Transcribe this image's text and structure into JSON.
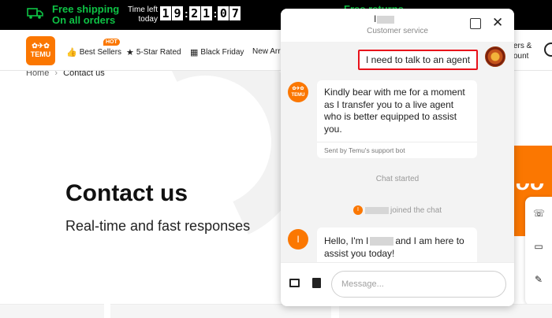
{
  "promo": {
    "shipping_line1": "Free shipping",
    "shipping_line2": "On all orders",
    "timer_label1": "Time left",
    "timer_label2": "today",
    "timer_digits": [
      "1",
      "9",
      "2",
      "1",
      "0",
      "7"
    ],
    "returns": "Free returns"
  },
  "nav": {
    "logo_text": "TEMU",
    "hot_badge": "HOT",
    "items": [
      {
        "label": "Best Sellers",
        "icon": "thumbs-up-icon"
      },
      {
        "label": "5-Star Rated",
        "icon": "star-badge-icon"
      },
      {
        "label": "Black Friday",
        "icon": "calendar-icon"
      },
      {
        "label": "New Arr",
        "icon": ""
      }
    ],
    "right_line1": "ers &",
    "right_line2": "ount"
  },
  "page": {
    "breadcrumb_home": "Home",
    "breadcrumb_sep": "›",
    "breadcrumb_current": "Contact us",
    "title": "Contact us",
    "subtitle": "Real-time and fast responses"
  },
  "chat": {
    "agent_initial": "I",
    "agent_role": "Customer service",
    "user_message": "I need to talk to an agent",
    "bot_logo_text": "TEMU",
    "bot_message": "Kindly bear with me for a moment as I transfer you to a live agent who is better equipped to assist you.",
    "bot_sent_by": "Sent by Temu's support bot",
    "chat_started": "Chat started",
    "joined_initial": "I",
    "joined_text": "joined the chat",
    "agent_msg_part1": "Hello, I'm I",
    "agent_msg_part2": "and I am here to assist you today!",
    "input_placeholder": "Message..."
  },
  "colors": {
    "brand_orange": "#fb7701",
    "highlight_red": "#e8111a",
    "promo_green": "#0ec245"
  }
}
